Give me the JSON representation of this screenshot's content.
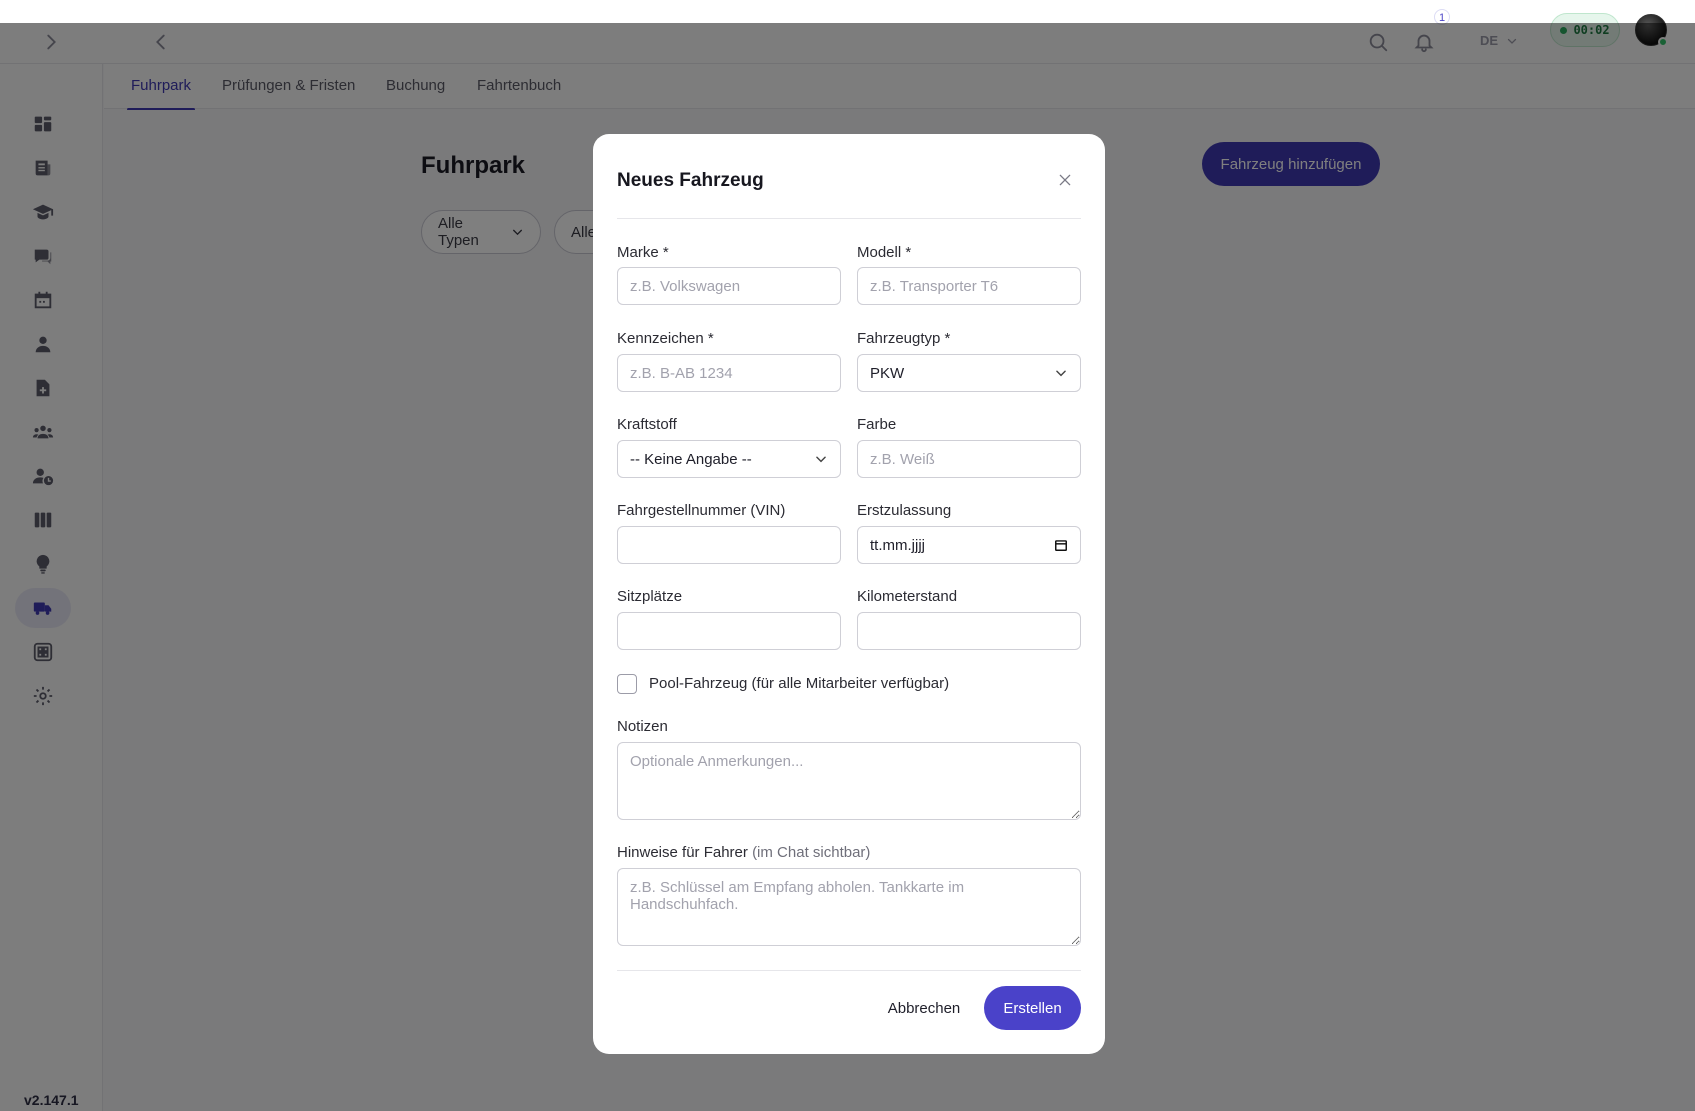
{
  "header": {
    "notification_count": "1",
    "language": "DE",
    "timer": "00:02"
  },
  "sidebar": {
    "items": [
      {
        "icon": "dashboard-icon"
      },
      {
        "icon": "news-icon"
      },
      {
        "icon": "graduation-cap-icon"
      },
      {
        "icon": "chat-icon"
      },
      {
        "icon": "calendar-icon"
      },
      {
        "icon": "user-icon"
      },
      {
        "icon": "file-plus-icon"
      },
      {
        "icon": "team-icon"
      },
      {
        "icon": "user-clock-icon"
      },
      {
        "icon": "columns-icon"
      },
      {
        "icon": "lightbulb-icon"
      },
      {
        "icon": "truck-icon",
        "active": true
      },
      {
        "icon": "apps-grid-icon"
      },
      {
        "icon": "gear-icon"
      }
    ],
    "version": "v2.147.1"
  },
  "tabs": [
    {
      "label": "Fuhrpark",
      "active": true
    },
    {
      "label": "Prüfungen & Fristen"
    },
    {
      "label": "Buchung"
    },
    {
      "label": "Fahrtenbuch"
    }
  ],
  "main": {
    "title": "Fuhrpark",
    "add_button": "Fahrzeug hinzufügen",
    "filters": [
      "Alle Typen",
      "Alle"
    ]
  },
  "modal": {
    "title": "Neues Fahrzeug",
    "fields": {
      "marke": {
        "label": "Marke *",
        "placeholder": "z.B. Volkswagen"
      },
      "modell": {
        "label": "Modell *",
        "placeholder": "z.B. Transporter T6"
      },
      "kennzeichen": {
        "label": "Kennzeichen *",
        "placeholder": "z.B. B-AB 1234"
      },
      "fahrzeugtyp": {
        "label": "Fahrzeugtyp *",
        "value": "PKW"
      },
      "kraftstoff": {
        "label": "Kraftstoff",
        "value": "-- Keine Angabe --"
      },
      "farbe": {
        "label": "Farbe",
        "placeholder": "z.B. Weiß"
      },
      "vin": {
        "label": "Fahrgestellnummer (VIN)",
        "value": ""
      },
      "erstzulassung": {
        "label": "Erstzulassung",
        "value": "tt.mm.jjjj"
      },
      "sitzplaetze": {
        "label": "Sitzplätze",
        "value": ""
      },
      "kilometerstand": {
        "label": "Kilometerstand",
        "value": ""
      }
    },
    "pool_checkbox": {
      "label": "Pool-Fahrzeug (für alle Mitarbeiter verfügbar)",
      "checked": false
    },
    "notizen": {
      "label": "Notizen",
      "placeholder": "Optionale Anmerkungen..."
    },
    "hinweise": {
      "label": "Hinweise für Fahrer",
      "label_hint": "(im Chat sichtbar)",
      "placeholder": "z.B. Schlüssel am Empfang abholen. Tankkarte im Handschuhfach."
    },
    "cancel_button": "Abbrechen",
    "submit_button": "Erstellen"
  },
  "colors": {
    "accent": "#3f38b3",
    "primary_button": "#4a42c9",
    "timer_green": "#2bab5e",
    "overlay": "rgba(0,0,0,0.5)"
  }
}
